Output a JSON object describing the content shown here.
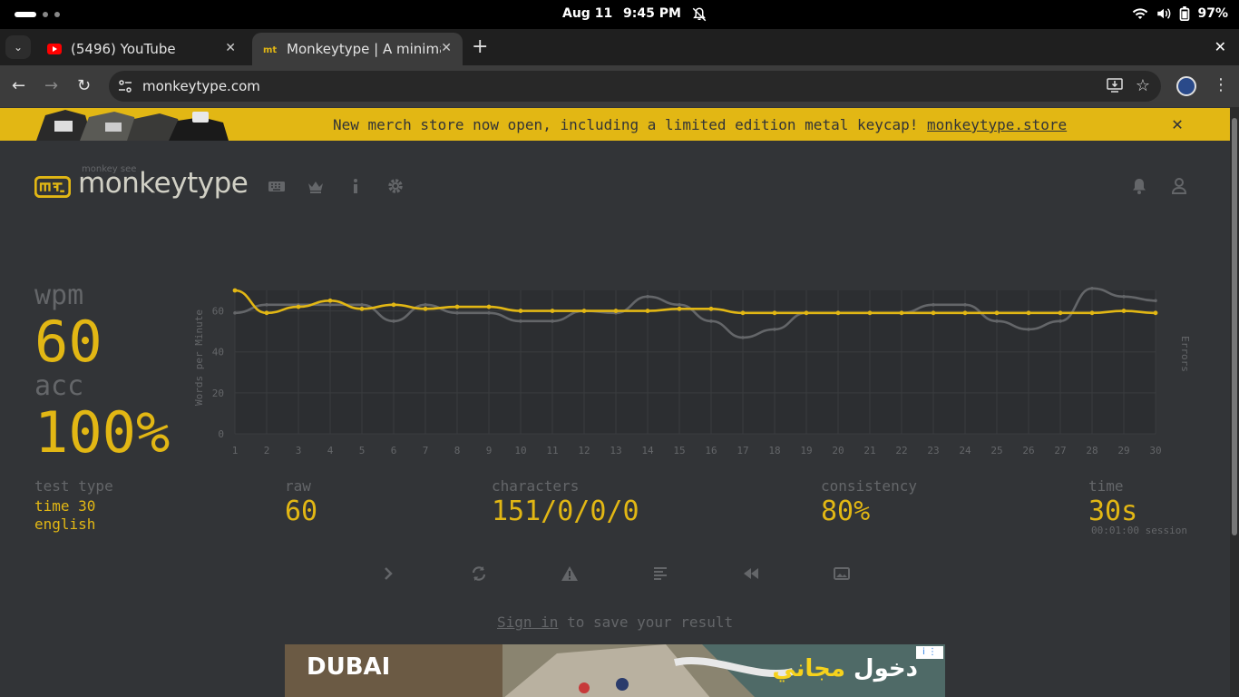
{
  "system": {
    "date": "Aug 11",
    "time": "9:45 PM",
    "battery": "97%",
    "icons": [
      "notifications-off-icon",
      "wifi-icon",
      "volume-icon",
      "battery-icon"
    ]
  },
  "browser": {
    "tabs": [
      {
        "title": "(5496) YouTube",
        "favicon": "youtube-icon",
        "favicon_color": "#ff0000",
        "active": false
      },
      {
        "title": "Monkeytype | A minimalistic",
        "favicon": "monkeytype-icon",
        "favicon_color": "#e2b714",
        "active": true
      }
    ],
    "url": "monkeytype.com"
  },
  "banner": {
    "text": "New merch store now open, including a limited edition metal keycap! ",
    "link": "monkeytype.store",
    "close": "✕"
  },
  "header": {
    "logo_small": "monkey see",
    "logo_text": "monkeytype",
    "nav": [
      "keyboard-icon",
      "crown-icon",
      "info-icon",
      "settings-icon"
    ],
    "right": [
      "bell-icon",
      "user-icon"
    ]
  },
  "colors": {
    "bg": "#323437",
    "main": "#e2b714",
    "sub": "#646669",
    "text": "#d1d0c5"
  },
  "result": {
    "wpm_label": "wpm",
    "wpm": "60",
    "acc_label": "acc",
    "acc": "100%",
    "test_type_label": "test type",
    "test_type": [
      "time 30",
      "english"
    ],
    "raw_label": "raw",
    "raw": "60",
    "characters_label": "characters",
    "characters": "151/0/0/0",
    "consistency_label": "consistency",
    "consistency": "80%",
    "time_label": "time",
    "time": "30s",
    "session": "00:01:00 session"
  },
  "chart_data": {
    "type": "line",
    "title": "",
    "ylabel": "Words per Minute",
    "y2label": "Errors",
    "ylim": [
      0,
      70
    ],
    "yticks": [
      0,
      20,
      40,
      60
    ],
    "x": [
      1,
      2,
      3,
      4,
      5,
      6,
      7,
      8,
      9,
      10,
      11,
      12,
      13,
      14,
      15,
      16,
      17,
      18,
      19,
      20,
      21,
      22,
      23,
      24,
      25,
      26,
      27,
      28,
      29,
      30
    ],
    "series": [
      {
        "color": "#e2b714",
        "values": [
          70,
          59,
          62,
          65,
          61,
          63,
          61,
          62,
          62,
          60,
          60,
          60,
          60,
          60,
          61,
          61,
          59,
          59,
          59,
          59,
          59,
          59,
          59,
          59,
          59,
          59,
          59,
          59,
          60,
          59
        ]
      },
      {
        "color": "#646669",
        "values": [
          59,
          63,
          63,
          63,
          63,
          55,
          63,
          59,
          59,
          55,
          55,
          60,
          59,
          67,
          63,
          55,
          47,
          51,
          59,
          59,
          59,
          59,
          63,
          63,
          55,
          51,
          55,
          71,
          67,
          65
        ]
      }
    ],
    "grid": true
  },
  "actions": [
    "next-test-icon",
    "restart-icon",
    "warning-icon",
    "words-history-icon",
    "replay-icon",
    "screenshot-icon"
  ],
  "signin": {
    "link": "Sign in",
    "rest": " to save your result"
  },
  "ad": {
    "brand": "DUBAI",
    "text_a": "دخول ",
    "text_b": "مجاني",
    "choices": "i ⋮"
  }
}
